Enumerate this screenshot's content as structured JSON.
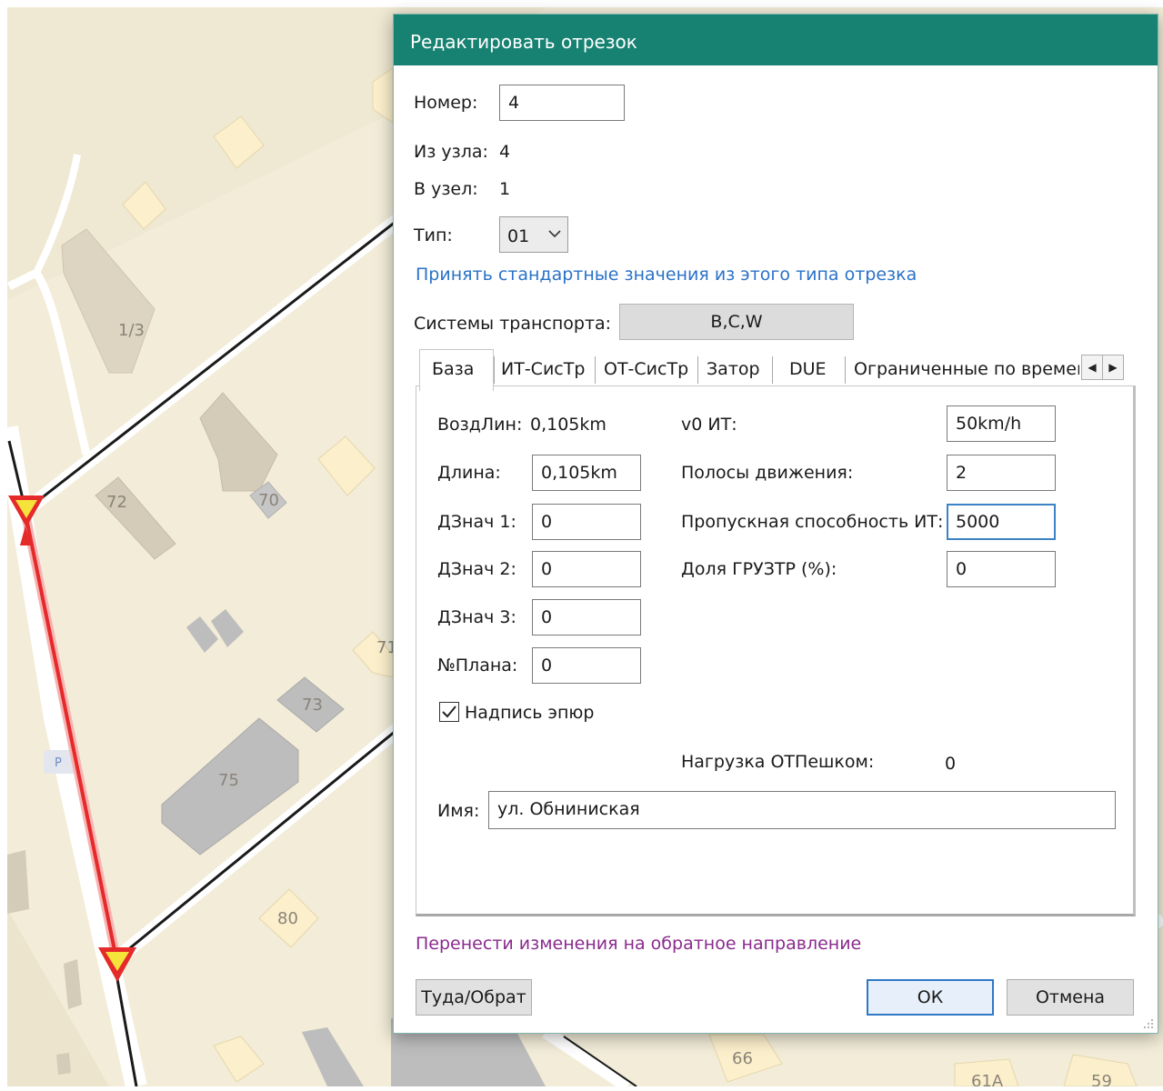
{
  "map": {
    "labels": [
      "1/3",
      "72",
      "70",
      "71",
      "73",
      "75",
      "80",
      "66",
      "61А",
      "59",
      "P"
    ]
  },
  "dialog": {
    "title": "Редактировать отрезок",
    "number_label": "Номер:",
    "number_value": "4",
    "from_node_label": "Из узла:",
    "from_node_value": "4",
    "to_node_label": "В узел:",
    "to_node_value": "1",
    "type_label": "Тип:",
    "type_value": "01",
    "accept_defaults_link": "Принять стандартные значения из этого типа отрезка",
    "transport_systems_label": "Системы транспорта:",
    "transport_systems_value": "B,C,W",
    "tabs": [
      {
        "label": "База",
        "active": true
      },
      {
        "label": "ИТ-СисТр"
      },
      {
        "label": "ОТ-СисТр"
      },
      {
        "label": "Затор"
      },
      {
        "label": "DUE"
      },
      {
        "label": "Ограниченные по времен"
      }
    ],
    "base": {
      "air_length_label": "ВоздЛин:",
      "air_length_value": "0,105km",
      "length_label": "Длина:",
      "length_value": "0,105km",
      "dval1_label": "ДЗнач 1:",
      "dval1_value": "0",
      "dval2_label": "ДЗнач 2:",
      "dval2_value": "0",
      "dval3_label": "ДЗнач 3:",
      "dval3_value": "0",
      "plan_label": "№Плана:",
      "plan_value": "0",
      "v0_label": "v0 ИТ:",
      "v0_value": "50km/h",
      "lanes_label": "Полосы движения:",
      "lanes_value": "2",
      "capacity_label": "Пропускная способность ИТ:",
      "capacity_value": "5000",
      "freight_label": "Доля ГРУЗТР (%):",
      "freight_value": "0",
      "diagram_label_checkbox": "Надпись эпюр",
      "diagram_label_checked": true,
      "pedestrian_load_label": "Нагрузка ОТПешком:",
      "pedestrian_load_value": "0",
      "name_label": "Имя:",
      "name_value": "ул. Обниниская"
    },
    "transfer_link": "Перенести изменения на обратное направление",
    "buttons": {
      "there_back": "Туда/Обрат",
      "ok": "ОК",
      "cancel": "Отмена"
    }
  }
}
